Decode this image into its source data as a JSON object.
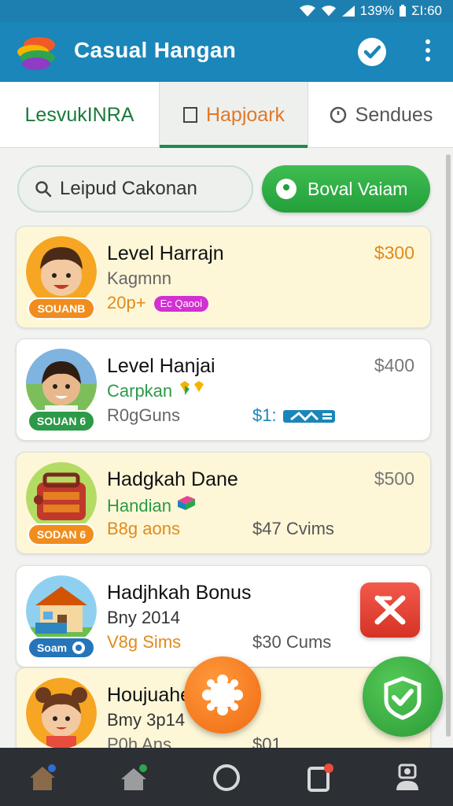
{
  "status_bar": {
    "battery_pct": "139%",
    "time": "ΣΙ:60"
  },
  "app": {
    "title": "Casual Hangan"
  },
  "tabs": [
    {
      "label": "LesvukINRA"
    },
    {
      "label": "Hapjoark"
    },
    {
      "label": "Sendues"
    }
  ],
  "search": {
    "placeholder": "Leipud Cakonan"
  },
  "action": {
    "label": "Boval Vaiam"
  },
  "cards": [
    {
      "title": "Level Harrajn",
      "sub": "Kagmnn",
      "third": "20p+",
      "tag": "Ec Qaooi",
      "price": "$300",
      "badge": "SOUANB",
      "extra": ""
    },
    {
      "title": "Level Hanjai",
      "sub": "Carpkan",
      "third": "R0gGuns",
      "price": "$400",
      "badge": "SOUAN 6",
      "extra": "$1:"
    },
    {
      "title": "Hadgkah Dane",
      "sub": "Handian",
      "third": "B8g aons",
      "price": "$500",
      "badge": "SODAN 6",
      "extra": "$47 Cvims"
    },
    {
      "title": "Hadjhkah Bonus",
      "sub": "Bny 2014",
      "third": "V8g Sims",
      "price": "",
      "badge": "Soam",
      "extra": "$30 Cums"
    },
    {
      "title": "Houjuahe",
      "sub": "Bmy 3p14",
      "third": "P0h Ans",
      "price": "",
      "badge": "",
      "extra": "$01"
    }
  ],
  "colors": {
    "app_bar": "#1a86b9",
    "accent_green": "#23a03a",
    "price_orange": "#e08a1c",
    "card_yellow": "#fdf7d8",
    "bottom_nav": "#2c2f33"
  },
  "icons": [
    "app-logo-icon",
    "check-circle-icon",
    "more-vert-icon",
    "search-icon",
    "chat-bubble-icon",
    "close-icon",
    "puzzle-icon",
    "check-icon",
    "home-icon",
    "house-icon",
    "circle-icon",
    "square-icon",
    "profile-icon"
  ]
}
